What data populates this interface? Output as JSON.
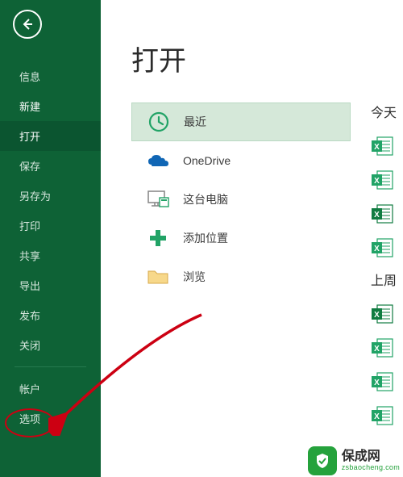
{
  "sidebar": {
    "items": [
      {
        "label": "信息",
        "active": false
      },
      {
        "label": "新建",
        "active": false,
        "bold": true
      },
      {
        "label": "打开",
        "active": true
      },
      {
        "label": "保存",
        "active": false
      },
      {
        "label": "另存为",
        "active": false
      },
      {
        "label": "打印",
        "active": false
      },
      {
        "label": "共享",
        "active": false
      },
      {
        "label": "导出",
        "active": false
      },
      {
        "label": "发布",
        "active": false
      },
      {
        "label": "关闭",
        "active": false
      }
    ],
    "footer": [
      {
        "label": "帐户"
      },
      {
        "label": "选项"
      }
    ]
  },
  "main": {
    "title": "打开",
    "sources": [
      {
        "icon": "clock-icon",
        "label": "最近",
        "selected": true
      },
      {
        "icon": "onedrive-icon",
        "label": "OneDrive",
        "selected": false
      },
      {
        "icon": "this-pc-icon",
        "label": "这台电脑",
        "selected": false
      },
      {
        "icon": "plus-icon",
        "label": "添加位置",
        "selected": false
      },
      {
        "icon": "folder-icon",
        "label": "浏览",
        "selected": false
      }
    ]
  },
  "recent": {
    "groups": [
      {
        "head": "今天",
        "count": 4
      },
      {
        "head": "上周",
        "count": 4
      }
    ]
  },
  "watermark": {
    "main": "保成网",
    "sub": "zsbaocheng.com"
  },
  "colors": {
    "brand": "#0e6236",
    "accent": "#21a366",
    "annotation": "#cc0012"
  }
}
